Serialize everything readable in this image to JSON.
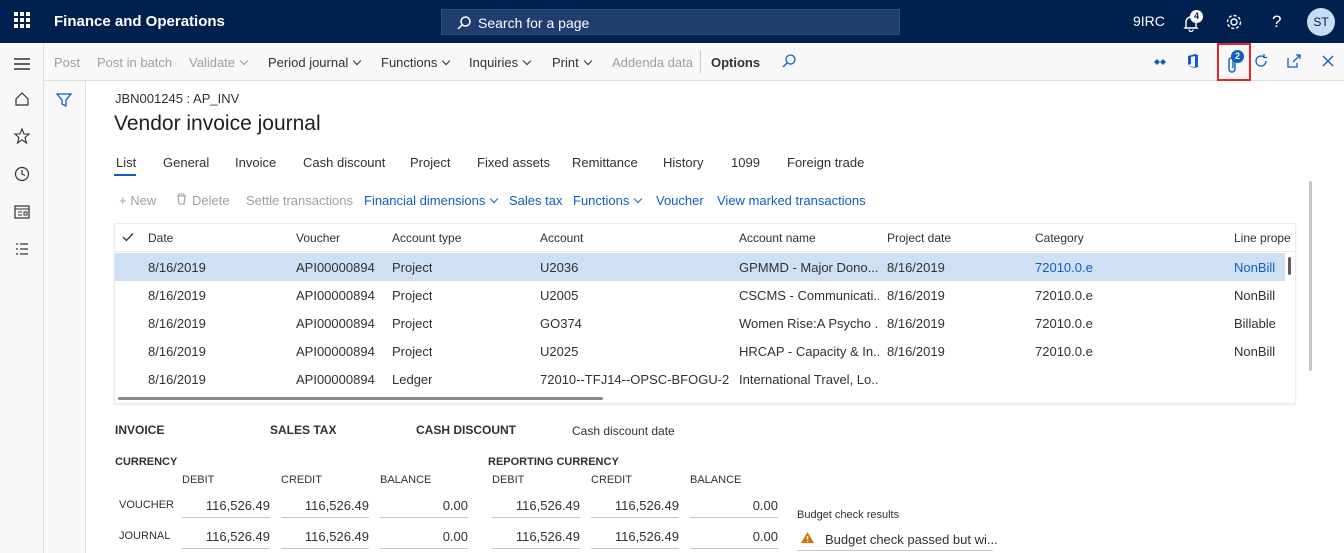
{
  "topbar": {
    "app_title": "Finance and Operations",
    "search_placeholder": "Search for a page",
    "company": "9IRC",
    "notifications_count": "4",
    "user_initials": "ST"
  },
  "actions": {
    "post": "Post",
    "post_in_batch": "Post in batch",
    "validate": "Validate",
    "period_journal": "Period journal",
    "functions": "Functions",
    "inquiries": "Inquiries",
    "print": "Print",
    "addenda": "Addenda data",
    "options": "Options",
    "attachments_count": "2"
  },
  "page": {
    "breadcrumb": "JBN001245 : AP_INV",
    "title": "Vendor invoice journal"
  },
  "tabs": [
    "List",
    "General",
    "Invoice",
    "Cash discount",
    "Project",
    "Fixed assets",
    "Remittance",
    "History",
    "1099",
    "Foreign trade"
  ],
  "grid_actions": {
    "new": "New",
    "delete": "Delete",
    "settle": "Settle transactions",
    "fin_dims": "Financial dimensions",
    "sales_tax": "Sales tax",
    "functions": "Functions",
    "voucher": "Voucher",
    "view_marked": "View marked transactions"
  },
  "grid": {
    "headers": [
      "Date",
      "Voucher",
      "Account type",
      "Account",
      "Account name",
      "Project date",
      "Category",
      "Line prope"
    ],
    "rows": [
      [
        "8/16/2019",
        "API00000894",
        "Project",
        "U2036",
        "GPMMD - Major Dono...",
        "8/16/2019",
        "72010.0.e",
        "NonBill"
      ],
      [
        "8/16/2019",
        "API00000894",
        "Project",
        "U2005",
        "CSCMS - Communicati...",
        "8/16/2019",
        "72010.0.e",
        "NonBill"
      ],
      [
        "8/16/2019",
        "API00000894",
        "Project",
        "GO374",
        "Women Rise:A Psycho ...",
        "8/16/2019",
        "72010.0.e",
        "Billable"
      ],
      [
        "8/16/2019",
        "API00000894",
        "Project",
        "U2025",
        "HRCAP - Capacity & In...",
        "8/16/2019",
        "72010.0.e",
        "NonBill"
      ],
      [
        "8/16/2019",
        "API00000894",
        "Ledger",
        "72010--TFJ14--OPSC-BFOGU-2...",
        "International Travel, Lo...",
        "",
        "",
        ""
      ]
    ]
  },
  "summary": {
    "invoice": "INVOICE",
    "sales_tax": "SALES TAX",
    "cash_discount": "CASH DISCOUNT",
    "cash_discount_date": "Cash discount date",
    "currency": "CURRENCY",
    "reporting_currency": "REPORTING CURRENCY",
    "debit": "DEBIT",
    "credit": "CREDIT",
    "balance": "BALANCE",
    "voucher_label": "VOUCHER",
    "journal_label": "JOURNAL",
    "voucher_values": [
      "116,526.49",
      "116,526.49",
      "0.00",
      "116,526.49",
      "116,526.49",
      "0.00"
    ],
    "journal_values": [
      "116,526.49",
      "116,526.49",
      "0.00",
      "116,526.49",
      "116,526.49",
      "0.00"
    ],
    "budget_label": "Budget check results",
    "budget_value": "Budget check passed but wi..."
  }
}
